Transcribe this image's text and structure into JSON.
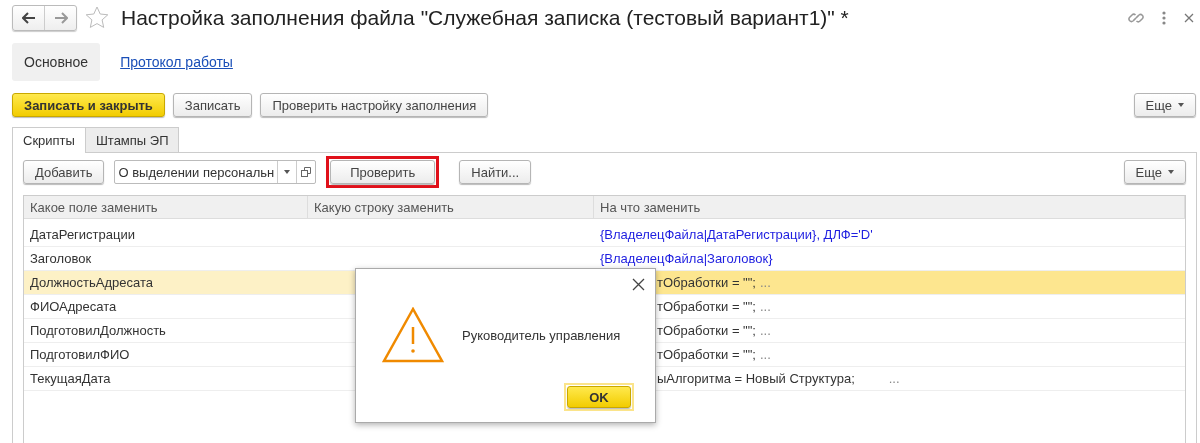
{
  "window": {
    "title": "Настройка заполнения файла \"Служебная записка (тестовый вариант1)\" *"
  },
  "sections": [
    {
      "label": "Основное",
      "selected": true
    },
    {
      "label": "Протокол работы",
      "selected": false
    }
  ],
  "commands": [
    {
      "label": "Записать и закрыть",
      "kind": "default"
    },
    {
      "label": "Записать",
      "kind": "plain"
    },
    {
      "label": "Проверить настройку заполнения",
      "kind": "plain"
    }
  ],
  "more_button": "Еще",
  "tabs": [
    {
      "label": "Скрипты",
      "selected": true
    },
    {
      "label": "Штампы ЭП",
      "selected": false
    }
  ],
  "toolbar": {
    "add_button": "Добавить",
    "script_select": "О выделении персональн",
    "check_button": {
      "label": "Проверить",
      "highlighted": true
    },
    "find_button": "Найти...",
    "more_button": "Еще"
  },
  "table": {
    "columns": [
      "Какое поле заменить",
      "Какую строку заменить",
      "На что заменить"
    ],
    "rows": [
      {
        "field": "ДатаРегистрации",
        "value": "{ВладелецФайла|ДатаРегистрации}, ДЛФ='D'",
        "kind": "template",
        "covered": false,
        "selected": false
      },
      {
        "field": "Заголовок",
        "value": "{ВладелецФайла|Заголовок}",
        "kind": "template",
        "covered": false,
        "selected": false
      },
      {
        "field": "ДолжностьАдресата",
        "value": "тОбработки = \"\";",
        "more": "...",
        "kind": "script",
        "covered": true,
        "selected": true
      },
      {
        "field": "ФИОАдресата",
        "value": "тОбработки = \"\";",
        "more": "...",
        "kind": "script",
        "covered": true,
        "selected": false
      },
      {
        "field": "ПодготовилДолжность",
        "value": "тОбработки = \"\";",
        "more": "...",
        "kind": "script",
        "covered": true,
        "selected": false
      },
      {
        "field": "ПодготовилФИО",
        "value": "тОбработки = \"\";",
        "more": "...",
        "kind": "script",
        "covered": true,
        "selected": false
      },
      {
        "field": "ТекущаяДата",
        "value": "ыАлгоритма = Новый Структура;",
        "more": "...",
        "kind": "script",
        "covered": true,
        "selected": false
      }
    ]
  },
  "dialog": {
    "message": "Руководитель управления",
    "ok_button": "OK"
  }
}
